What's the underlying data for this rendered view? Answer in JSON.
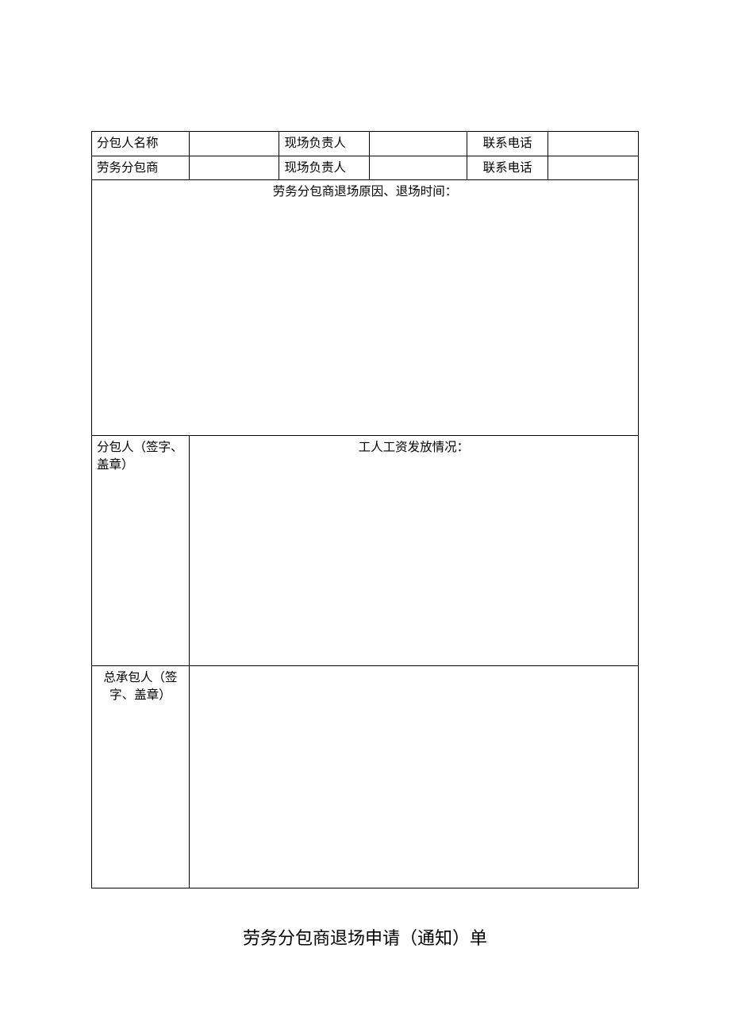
{
  "table": {
    "row1": {
      "label1": "分包人名称",
      "value1": "",
      "label2": "现场负责人",
      "value2": "",
      "label3": "联系电话",
      "value3": ""
    },
    "row2": {
      "label1": "劳务分包商",
      "value1": "",
      "label2": "现场负责人",
      "value2": "",
      "label3": "联系电话",
      "value3": ""
    },
    "reason_section": {
      "heading": "劳务分包商退场原因、退场时间：",
      "content": ""
    },
    "wage_section": {
      "label": "分包人（签字、盖章）",
      "heading": "工人工资发放情况：",
      "content": ""
    },
    "contractor_section": {
      "label": "总承包人（签字、盖章）",
      "content": ""
    }
  },
  "footer_title": "劳务分包商退场申请（通知）单"
}
